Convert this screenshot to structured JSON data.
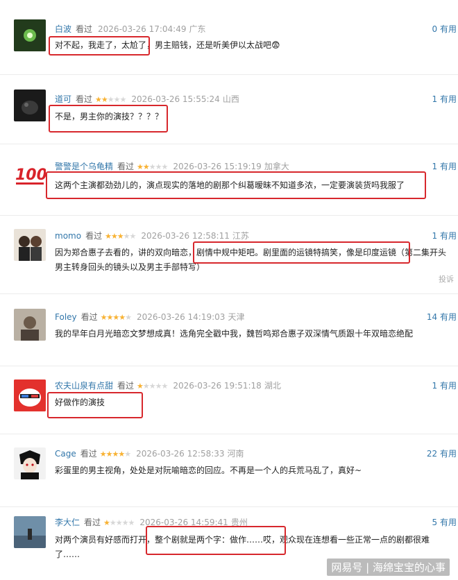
{
  "watched_label": "看过",
  "comments": [
    {
      "user": "白波",
      "stars": 0,
      "time": "2026-03-26 17:04:49",
      "loc": "广东",
      "useful": "0 有用",
      "lines": [
        "对不起，我走了，太尬了，男主赔钱，还是听美伊以太战吧😨"
      ]
    },
    {
      "user": "道可",
      "stars": 2,
      "time": "2026-03-26 15:55:24",
      "loc": "山西",
      "useful": "1 有用",
      "lines": [
        "不是，男主你的演技？？？？"
      ]
    },
    {
      "user": "警警是个乌龟精",
      "stars": 2,
      "time": "2026-03-26 15:19:19",
      "loc": "加拿大",
      "useful": "1 有用",
      "lines": [
        "这两个主演都劲劲儿的，演点现实的落地的剧那个纠葛暧昧不知道多浓，一定要演装货吗我服了"
      ]
    },
    {
      "user": "momo",
      "stars": 3,
      "time": "2026-03-26 12:58:11",
      "loc": "江苏",
      "useful": "1 有用",
      "lines": [
        "因为郑合惠子去看的，讲的双向暗恋，剧情中规中矩吧。剧里面的运镜特搞笑，像是印度运镜（第二集开头",
        "男主转身回头的镜头以及男主手部特写）"
      ],
      "report": "投诉"
    },
    {
      "user": "Foley",
      "stars": 4,
      "time": "2026-03-26 14:19:03",
      "loc": "天津",
      "useful": "14 有用",
      "lines": [
        "我的早年白月光暗恋文梦想成真！选角完全戳中我，魏哲鸣郑合惠子双深情气质跟十年双暗恋绝配"
      ]
    },
    {
      "user": "农夫山泉有点甜",
      "stars": 1,
      "time": "2026-03-26 19:51:18",
      "loc": "湖北",
      "useful": "1 有用",
      "lines": [
        "好做作的演技"
      ]
    },
    {
      "user": "Cage",
      "stars": 4,
      "time": "2026-03-26 12:58:33",
      "loc": "河南",
      "useful": "22 有用",
      "lines": [
        "彩蛋里的男主视角，处处是对阮喻暗恋的回应。不再是一个人的兵荒马乱了，真好~"
      ]
    },
    {
      "user": "李大仁",
      "stars": 1,
      "time": "2026-03-26 14:59:41",
      "loc": "贵州",
      "useful": "5 有用",
      "lines": [
        "对两个演员有好感而打开，整个剧就是两个字：做作……哎，观众现在连想看一些正常一点的剧都很难",
        "了……"
      ]
    }
  ],
  "watermark": "网易号 | 海绵宝宝的心事"
}
